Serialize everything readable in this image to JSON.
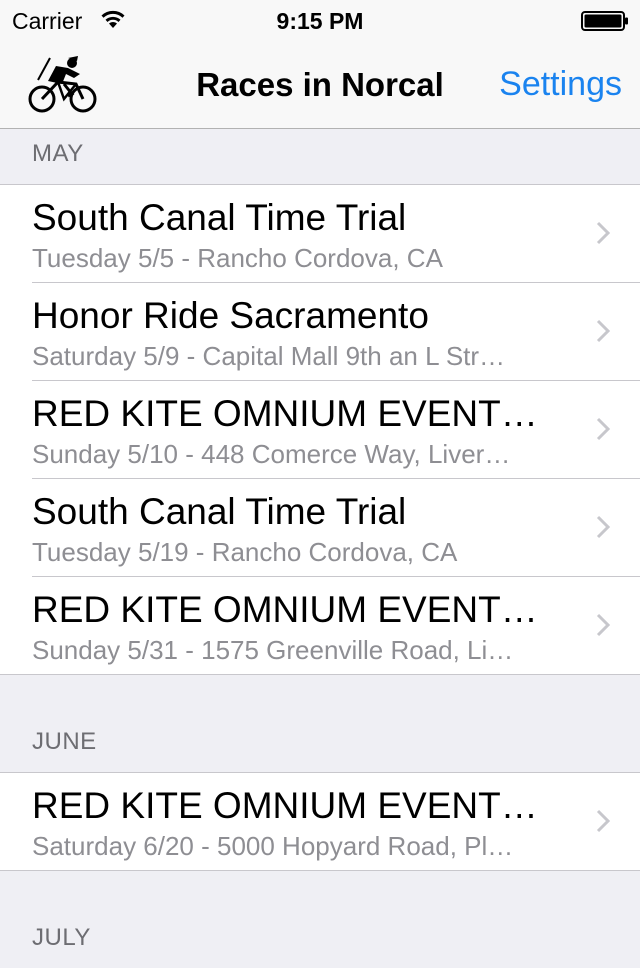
{
  "status_bar": {
    "carrier": "Carrier",
    "time": "9:15 PM"
  },
  "nav": {
    "title": "Races in Norcal",
    "settings_label": "Settings",
    "accent_color": "#1a83ef",
    "logo_icon": "cyclist-logo-icon"
  },
  "sections": [
    {
      "title": "MAY",
      "rows": [
        {
          "title": "South Canal Time Trial",
          "subtitle": "Tuesday 5/5 - Rancho Cordova, CA"
        },
        {
          "title": "Honor Ride Sacramento",
          "subtitle": "Saturday 5/9 - Capital Mall 9th an L Str…"
        },
        {
          "title": "RED KITE OMNIUM EVENT…",
          "subtitle": "Sunday 5/10 - 448 Comerce Way, Liver…"
        },
        {
          "title": "South Canal Time Trial",
          "subtitle": "Tuesday 5/19 - Rancho Cordova, CA"
        },
        {
          "title": "RED KITE OMNIUM EVENT…",
          "subtitle": "Sunday 5/31 - 1575 Greenville Road, Li…"
        }
      ]
    },
    {
      "title": "JUNE",
      "rows": [
        {
          "title": "RED KITE OMNIUM EVENT…",
          "subtitle": "Saturday 6/20 - 5000 Hopyard Road, Pl…"
        }
      ]
    },
    {
      "title": "JULY",
      "rows": []
    }
  ]
}
